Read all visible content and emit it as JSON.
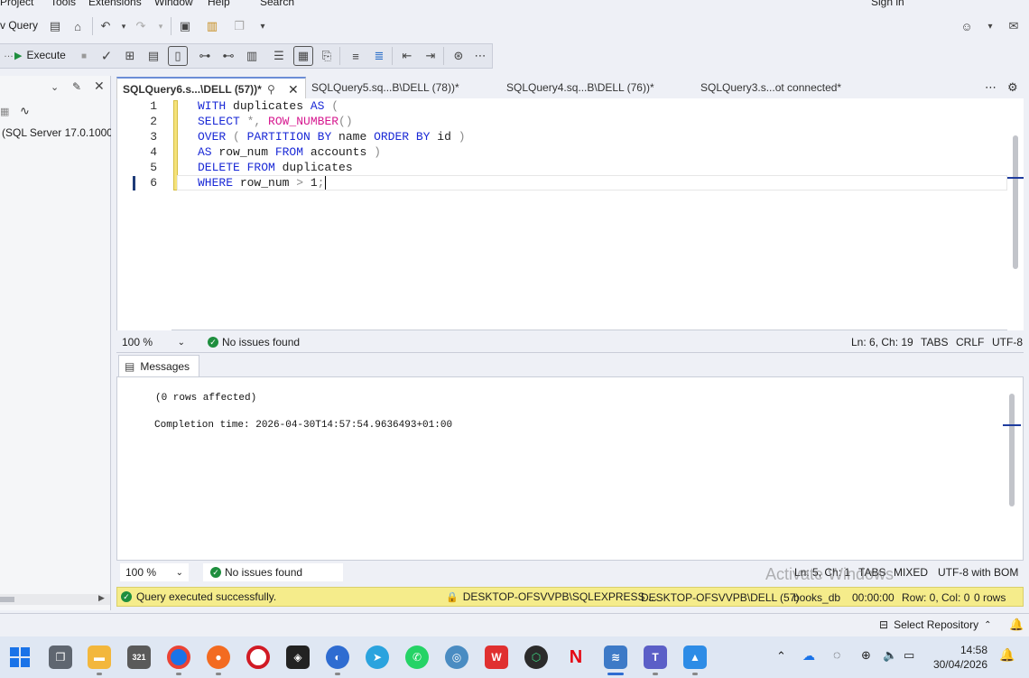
{
  "menu": {
    "items": [
      "Project",
      "Tools",
      "Extensions",
      "Window",
      "Help",
      "Search"
    ],
    "signin": "Sign in"
  },
  "toolbar": {
    "new_query": "v Query",
    "execute": "Execute"
  },
  "left_panel": {
    "server": "(SQL Server 17.0.1000 -"
  },
  "tabs": [
    {
      "label": "SQLQuery6.s...\\DELL (57))*",
      "active": true
    },
    {
      "label": "SQLQuery5.sq...B\\DELL (78))*",
      "active": false
    },
    {
      "label": "SQLQuery4.sq...B\\DELL (76))*",
      "active": false
    },
    {
      "label": "SQLQuery3.s...ot connected*",
      "active": false
    }
  ],
  "editor": {
    "line_numbers": [
      "1",
      "2",
      "3",
      "4",
      "5",
      "6"
    ],
    "lines": [
      [
        {
          "t": "WITH",
          "c": "kw"
        },
        {
          "t": " duplicates ",
          "c": ""
        },
        {
          "t": "AS",
          "c": "kw"
        },
        {
          "t": " (",
          "c": "op"
        }
      ],
      [
        {
          "t": "SELECT",
          "c": "kw"
        },
        {
          "t": " *, ",
          "c": "op"
        },
        {
          "t": "ROW_NUMBER",
          "c": "fn"
        },
        {
          "t": "()",
          "c": "op"
        }
      ],
      [
        {
          "t": "OVER",
          "c": "kw"
        },
        {
          "t": " ( ",
          "c": "op"
        },
        {
          "t": "PARTITION BY",
          "c": "kw"
        },
        {
          "t": " name ",
          "c": ""
        },
        {
          "t": "ORDER BY",
          "c": "kw"
        },
        {
          "t": " id ",
          "c": ""
        },
        {
          "t": ")",
          "c": "op"
        }
      ],
      [
        {
          "t": "AS",
          "c": "kw"
        },
        {
          "t": " row_num ",
          "c": ""
        },
        {
          "t": "FROM",
          "c": "kw"
        },
        {
          "t": " accounts ",
          "c": ""
        },
        {
          "t": ")",
          "c": "op"
        }
      ],
      [
        {
          "t": "DELETE FROM",
          "c": "kw"
        },
        {
          "t": " duplicates",
          "c": ""
        }
      ],
      [
        {
          "t": "WHERE",
          "c": "kw"
        },
        {
          "t": " row_num ",
          "c": ""
        },
        {
          "t": ">",
          "c": "op"
        },
        {
          "t": " 1",
          "c": ""
        },
        {
          "t": ";",
          "c": "op"
        }
      ]
    ]
  },
  "editor_status": {
    "zoom": "100 %",
    "issues": "No issues found",
    "position": "Ln: 6, Ch: 19",
    "tabs": "TABS",
    "line_ending": "CRLF",
    "encoding": "UTF-8"
  },
  "messages": {
    "tab": "Messages",
    "rows_affected": "(0 rows affected)",
    "completion": "Completion time: 2026-04-30T14:57:54.9636493+01:00"
  },
  "messages_status": {
    "zoom": "100 %",
    "issues": "No issues found",
    "position": "Ln: 5, Ch: 1",
    "tabs": "TABS",
    "line_ending": "MIXED",
    "encoding": "UTF-8 with BOM"
  },
  "query_status": {
    "status": "Query executed successfully.",
    "server": "DESKTOP-OFSVVPB\\SQLEXPRESS ...",
    "user": "DESKTOP-OFSVVPB\\DELL (57)",
    "database": "books_db",
    "elapsed": "00:00:00",
    "rowcol": "Row: 0, Col: 0",
    "rows": "0 rows"
  },
  "watermark": "Activate Windows",
  "bottom": {
    "repository": "Select Repository"
  },
  "taskbar": {
    "time": "14:58",
    "date": "30/04/2026"
  },
  "colors": {
    "keyword": "#1a29d6",
    "function": "#d6188f",
    "status_bar": "#f5ec8b",
    "success": "#1e8e3e"
  }
}
